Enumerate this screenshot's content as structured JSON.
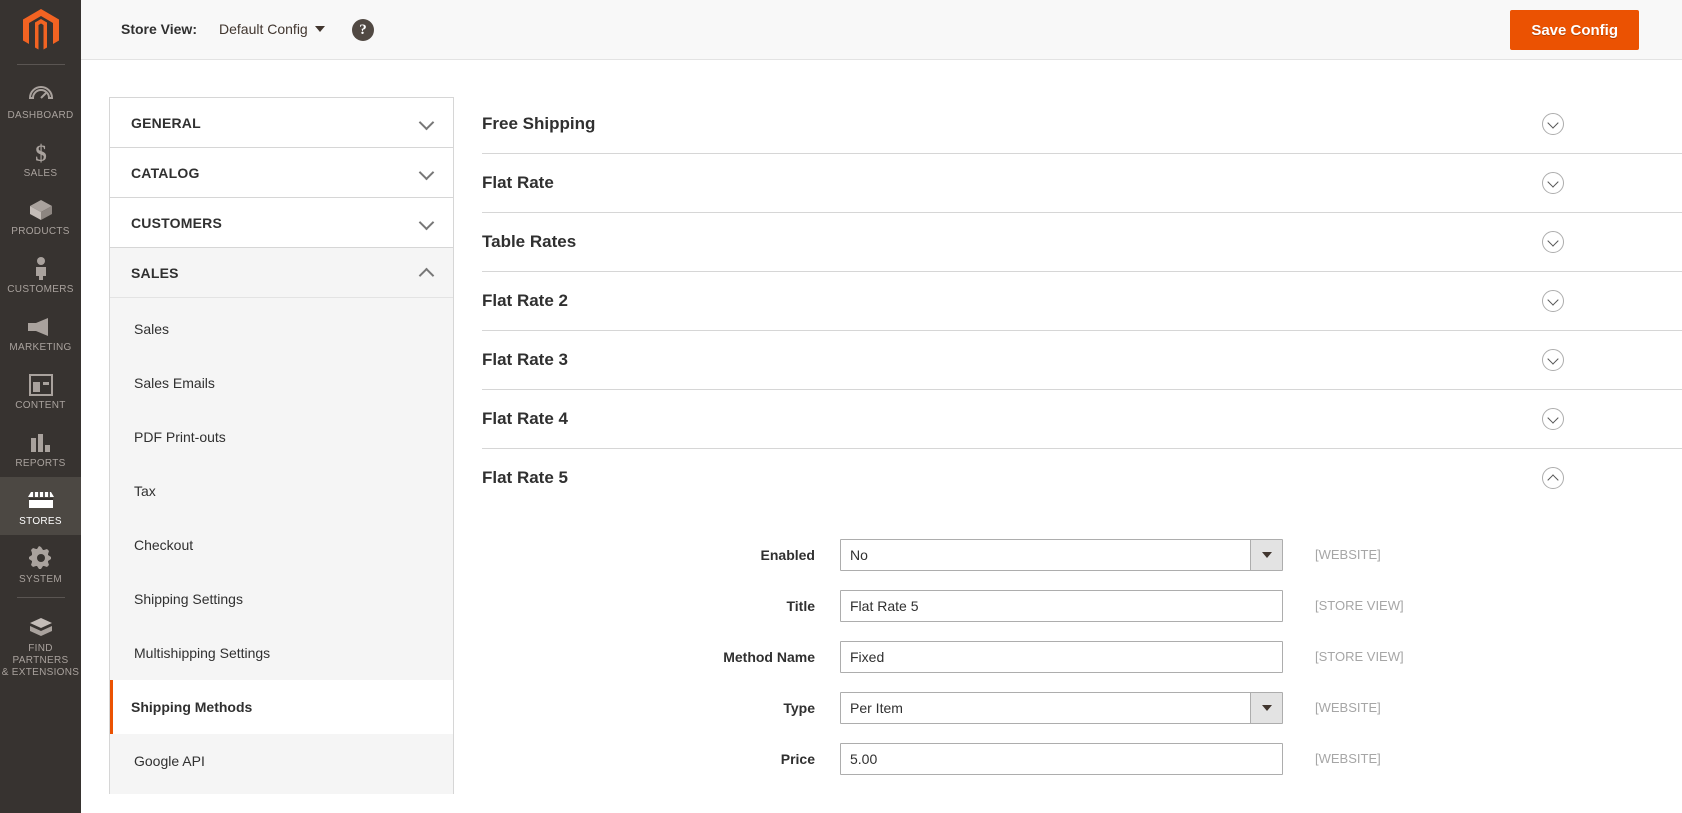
{
  "rail": {
    "logo_icon": "magento-logo-icon",
    "items": [
      {
        "label": "Dashboard",
        "icon": "dashboard-icon",
        "active": false
      },
      {
        "label": "Sales",
        "icon": "dollar-icon",
        "active": false
      },
      {
        "label": "Products",
        "icon": "box-icon",
        "active": false
      },
      {
        "label": "Customers",
        "icon": "person-icon",
        "active": false
      },
      {
        "label": "Marketing",
        "icon": "megaphone-icon",
        "active": false
      },
      {
        "label": "Content",
        "icon": "layout-icon",
        "active": false
      },
      {
        "label": "Reports",
        "icon": "bar-chart-icon",
        "active": false
      },
      {
        "label": "Stores",
        "icon": "storefront-icon",
        "active": true
      },
      {
        "label": "System",
        "icon": "gear-icon",
        "active": false
      },
      {
        "label": "Find Partners\n& Extensions",
        "icon": "extension-box-icon",
        "active": false
      }
    ]
  },
  "header": {
    "store_view_label": "Store View:",
    "store_view_value": "Default Config",
    "help_icon": "question-mark-icon",
    "save_label": "Save Config",
    "save_color": "#eb5202"
  },
  "config_nav": {
    "sections": [
      {
        "label": "General",
        "open": false
      },
      {
        "label": "Catalog",
        "open": false
      },
      {
        "label": "Customers",
        "open": false
      },
      {
        "label": "Sales",
        "open": true
      }
    ],
    "sales_items": [
      {
        "label": "Sales",
        "active": false
      },
      {
        "label": "Sales Emails",
        "active": false
      },
      {
        "label": "PDF Print-outs",
        "active": false
      },
      {
        "label": "Tax",
        "active": false
      },
      {
        "label": "Checkout",
        "active": false
      },
      {
        "label": "Shipping Settings",
        "active": false
      },
      {
        "label": "Multishipping Settings",
        "active": false
      },
      {
        "label": "Shipping Methods",
        "active": true
      },
      {
        "label": "Google API",
        "active": false
      }
    ]
  },
  "main": {
    "sections": [
      {
        "title": "Free Shipping",
        "expanded": false
      },
      {
        "title": "Flat Rate",
        "expanded": false
      },
      {
        "title": "Table Rates",
        "expanded": false
      },
      {
        "title": "Flat Rate 2",
        "expanded": false
      },
      {
        "title": "Flat Rate 3",
        "expanded": false
      },
      {
        "title": "Flat Rate 4",
        "expanded": false
      },
      {
        "title": "Flat Rate 5",
        "expanded": true
      }
    ],
    "flat_rate_5_fields": [
      {
        "label": "Enabled",
        "type": "select",
        "value": "No",
        "scope": "[WEBSITE]"
      },
      {
        "label": "Title",
        "type": "text",
        "value": "Flat Rate 5",
        "scope": "[STORE VIEW]"
      },
      {
        "label": "Method Name",
        "type": "text",
        "value": "Fixed",
        "scope": "[STORE VIEW]"
      },
      {
        "label": "Type",
        "type": "select",
        "value": "Per Item",
        "scope": "[WEBSITE]"
      },
      {
        "label": "Price",
        "type": "text",
        "value": "5.00",
        "scope": "[WEBSITE]"
      }
    ]
  }
}
